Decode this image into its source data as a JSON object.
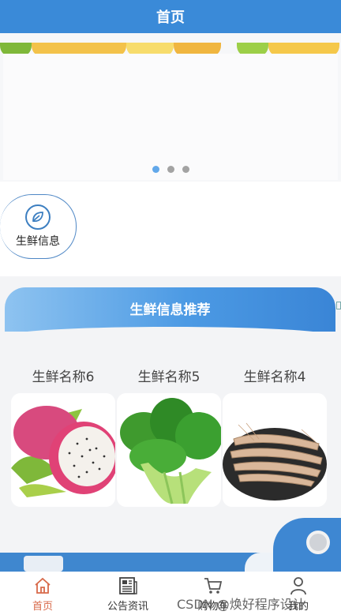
{
  "header": {
    "title": "首页"
  },
  "banner": {
    "dots": 3,
    "active_dot": 0
  },
  "categories": [
    {
      "label": "生鲜信息",
      "icon": "leaf-icon"
    }
  ],
  "recommend": {
    "title": "生鲜信息推荐",
    "products": [
      {
        "name": "生鲜名称6",
        "image": "dragon-fruit-image"
      },
      {
        "name": "生鲜名称5",
        "image": "bok-choy-image"
      },
      {
        "name": "生鲜名称4",
        "image": "shrimp-image"
      }
    ]
  },
  "tabbar": {
    "items": [
      {
        "label": "首页",
        "icon": "home-icon",
        "active": true
      },
      {
        "label": "公告资讯",
        "icon": "news-icon",
        "active": false
      },
      {
        "label": "购物车",
        "icon": "cart-icon",
        "active": false
      },
      {
        "label": "我的",
        "icon": "user-icon",
        "active": false
      }
    ]
  },
  "watermark": "CSDN @焕好程序设计",
  "colors": {
    "primary": "#3a8ad8",
    "active_tab": "#d86a4a"
  }
}
